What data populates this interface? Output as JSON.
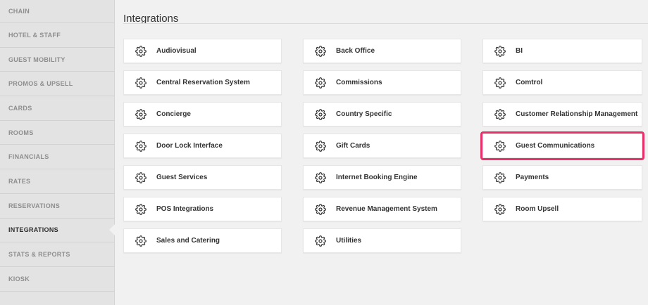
{
  "sidebar": {
    "items": [
      {
        "label": "CHAIN",
        "active": false
      },
      {
        "label": "HOTEL & STAFF",
        "active": false
      },
      {
        "label": "GUEST MOBILITY",
        "active": false
      },
      {
        "label": "PROMOS & UPSELL",
        "active": false
      },
      {
        "label": "CARDS",
        "active": false
      },
      {
        "label": "ROOMS",
        "active": false
      },
      {
        "label": "FINANCIALS",
        "active": false
      },
      {
        "label": "RATES",
        "active": false
      },
      {
        "label": "RESERVATIONS",
        "active": false
      },
      {
        "label": "INTEGRATIONS",
        "active": true
      },
      {
        "label": "STATS & REPORTS",
        "active": false
      },
      {
        "label": "KIOSK",
        "active": false
      }
    ]
  },
  "main": {
    "title": "Integrations",
    "cards": [
      {
        "label": "Audiovisual",
        "icon": "gear-icon"
      },
      {
        "label": "Back Office",
        "icon": "gear-icon"
      },
      {
        "label": "BI",
        "icon": "gear-icon"
      },
      {
        "label": "Central Reservation System",
        "icon": "gear-icon"
      },
      {
        "label": "Commissions",
        "icon": "gear-icon"
      },
      {
        "label": "Comtrol",
        "icon": "gear-icon"
      },
      {
        "label": "Concierge",
        "icon": "gear-icon"
      },
      {
        "label": "Country Specific",
        "icon": "gear-icon"
      },
      {
        "label": "Customer Relationship Management",
        "icon": "gear-icon"
      },
      {
        "label": "Door Lock Interface",
        "icon": "gear-icon"
      },
      {
        "label": "Gift Cards",
        "icon": "gear-icon"
      },
      {
        "label": "Guest Communications",
        "icon": "gear-icon",
        "highlighted": true
      },
      {
        "label": "Guest Services",
        "icon": "gear-icon"
      },
      {
        "label": "Internet Booking Engine",
        "icon": "gear-icon"
      },
      {
        "label": "Payments",
        "icon": "gear-icon"
      },
      {
        "label": "POS Integrations",
        "icon": "gear-icon"
      },
      {
        "label": "Revenue Management System",
        "icon": "gear-icon"
      },
      {
        "label": "Room Upsell",
        "icon": "gear-icon"
      },
      {
        "label": "Sales and Catering",
        "icon": "gear-icon"
      },
      {
        "label": "Utilities",
        "icon": "gear-icon"
      }
    ]
  },
  "colors": {
    "highlight": "#e8306a",
    "sidebar_bg": "#e3e3e3",
    "page_bg": "#f1f1f1"
  }
}
